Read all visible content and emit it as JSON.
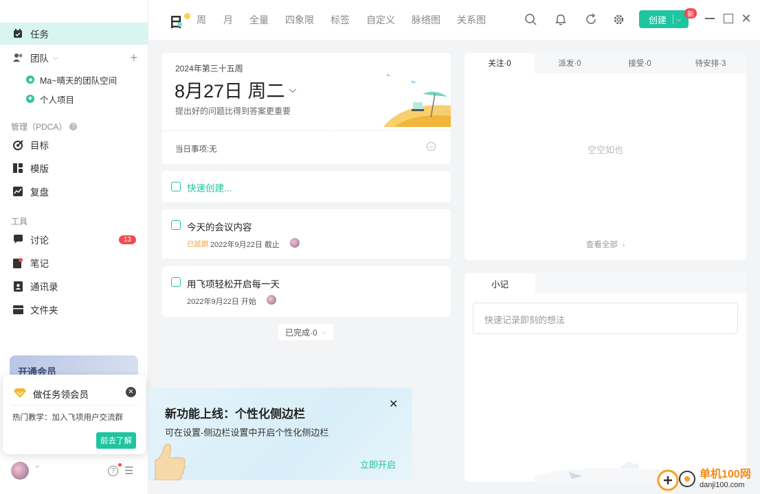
{
  "sidebar": {
    "tasks": "任务",
    "team": "团队",
    "team_items": [
      "Ma~晴天的团队空间",
      "个人项目"
    ],
    "mgmt_label": "管理（PDCA）",
    "mgmt_items": [
      "目标",
      "模版",
      "复盘"
    ],
    "tools_label": "工具",
    "tool_items": [
      "讨论",
      "笔记",
      "通讯录",
      "文件夹"
    ],
    "discuss_count": "13",
    "vip_card": "开通会员",
    "vip_pop": {
      "title": "做任务领会员",
      "text": "热门教学：加入飞项用户交流群",
      "button": "前去了解"
    }
  },
  "topbar": {
    "logo": "日",
    "tabs": [
      "周",
      "月",
      "全量",
      "四象限",
      "标签",
      "自定义",
      "脉络图",
      "关系图"
    ],
    "create": "创建",
    "new_tag": "新"
  },
  "date_card": {
    "week": "2024年第三十五周",
    "date": "8月27日 周二",
    "motto": "提出好的问题比得到答案更重要",
    "day_items": "当日事项:无"
  },
  "quick_create": "快速创建...",
  "tasks": [
    {
      "title": "今天的会议内容",
      "status": "已延期",
      "meta": "2022年9月22日 截止"
    },
    {
      "title": "用飞项轻松开启每一天",
      "status": "",
      "meta": "2022年9月22日 开始"
    }
  ],
  "completed": "已完成·0",
  "follow": {
    "tabs": [
      "关注·0",
      "派发·0",
      "接受·0",
      "待安排·3"
    ],
    "empty": "空空如也",
    "view_all": "查看全部"
  },
  "note": {
    "tab": "小记",
    "placeholder": "快速记录即刻的想法"
  },
  "promo": {
    "title": "新功能上线：个性化侧边栏",
    "desc": "可在设置-侧边栏设置中开启个性化侧边栏",
    "action": "立即开启"
  },
  "watermark": {
    "name": "单机100网",
    "url": "danji100.com"
  },
  "colors": {
    "accent": "#1fc4a0",
    "badge": "#f5484f"
  }
}
